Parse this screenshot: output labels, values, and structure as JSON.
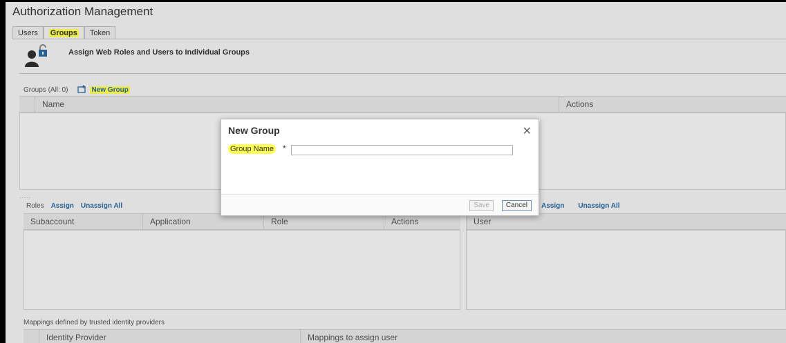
{
  "app": {
    "title": "Authorization Management"
  },
  "tabs": [
    {
      "label": "Users",
      "active": false
    },
    {
      "label": "Groups",
      "active": true
    },
    {
      "label": "Token",
      "active": false
    }
  ],
  "header": {
    "text": "Assign Web Roles and Users to Individual Groups",
    "icon": "user-lock-icon"
  },
  "groups": {
    "count_label": "Groups (All: 0)",
    "new_group_label": "New Group",
    "columns": [
      "Name",
      "Actions"
    ]
  },
  "roles": {
    "label": "Roles",
    "assign_label": "Assign",
    "unassign_label": "Unassign All",
    "columns": [
      "Subaccount",
      "Application",
      "Role",
      "Actions"
    ]
  },
  "users": {
    "assign_label": "Assign",
    "unassign_label": "Unassign All",
    "columns": [
      "User"
    ]
  },
  "mappings": {
    "label": "Mappings defined by trusted identity providers",
    "columns": [
      "Identity Provider",
      "Mappings to assign user"
    ]
  },
  "dialog": {
    "title": "New Group",
    "close_icon": "close-icon",
    "field_label": "Group Name",
    "required_marker": "*",
    "field_value": "",
    "save_label": "Save",
    "cancel_label": "Cancel"
  },
  "colors": {
    "highlight": "#ffff55",
    "link": "#2b6aa1",
    "background": "#f2f2f2"
  }
}
